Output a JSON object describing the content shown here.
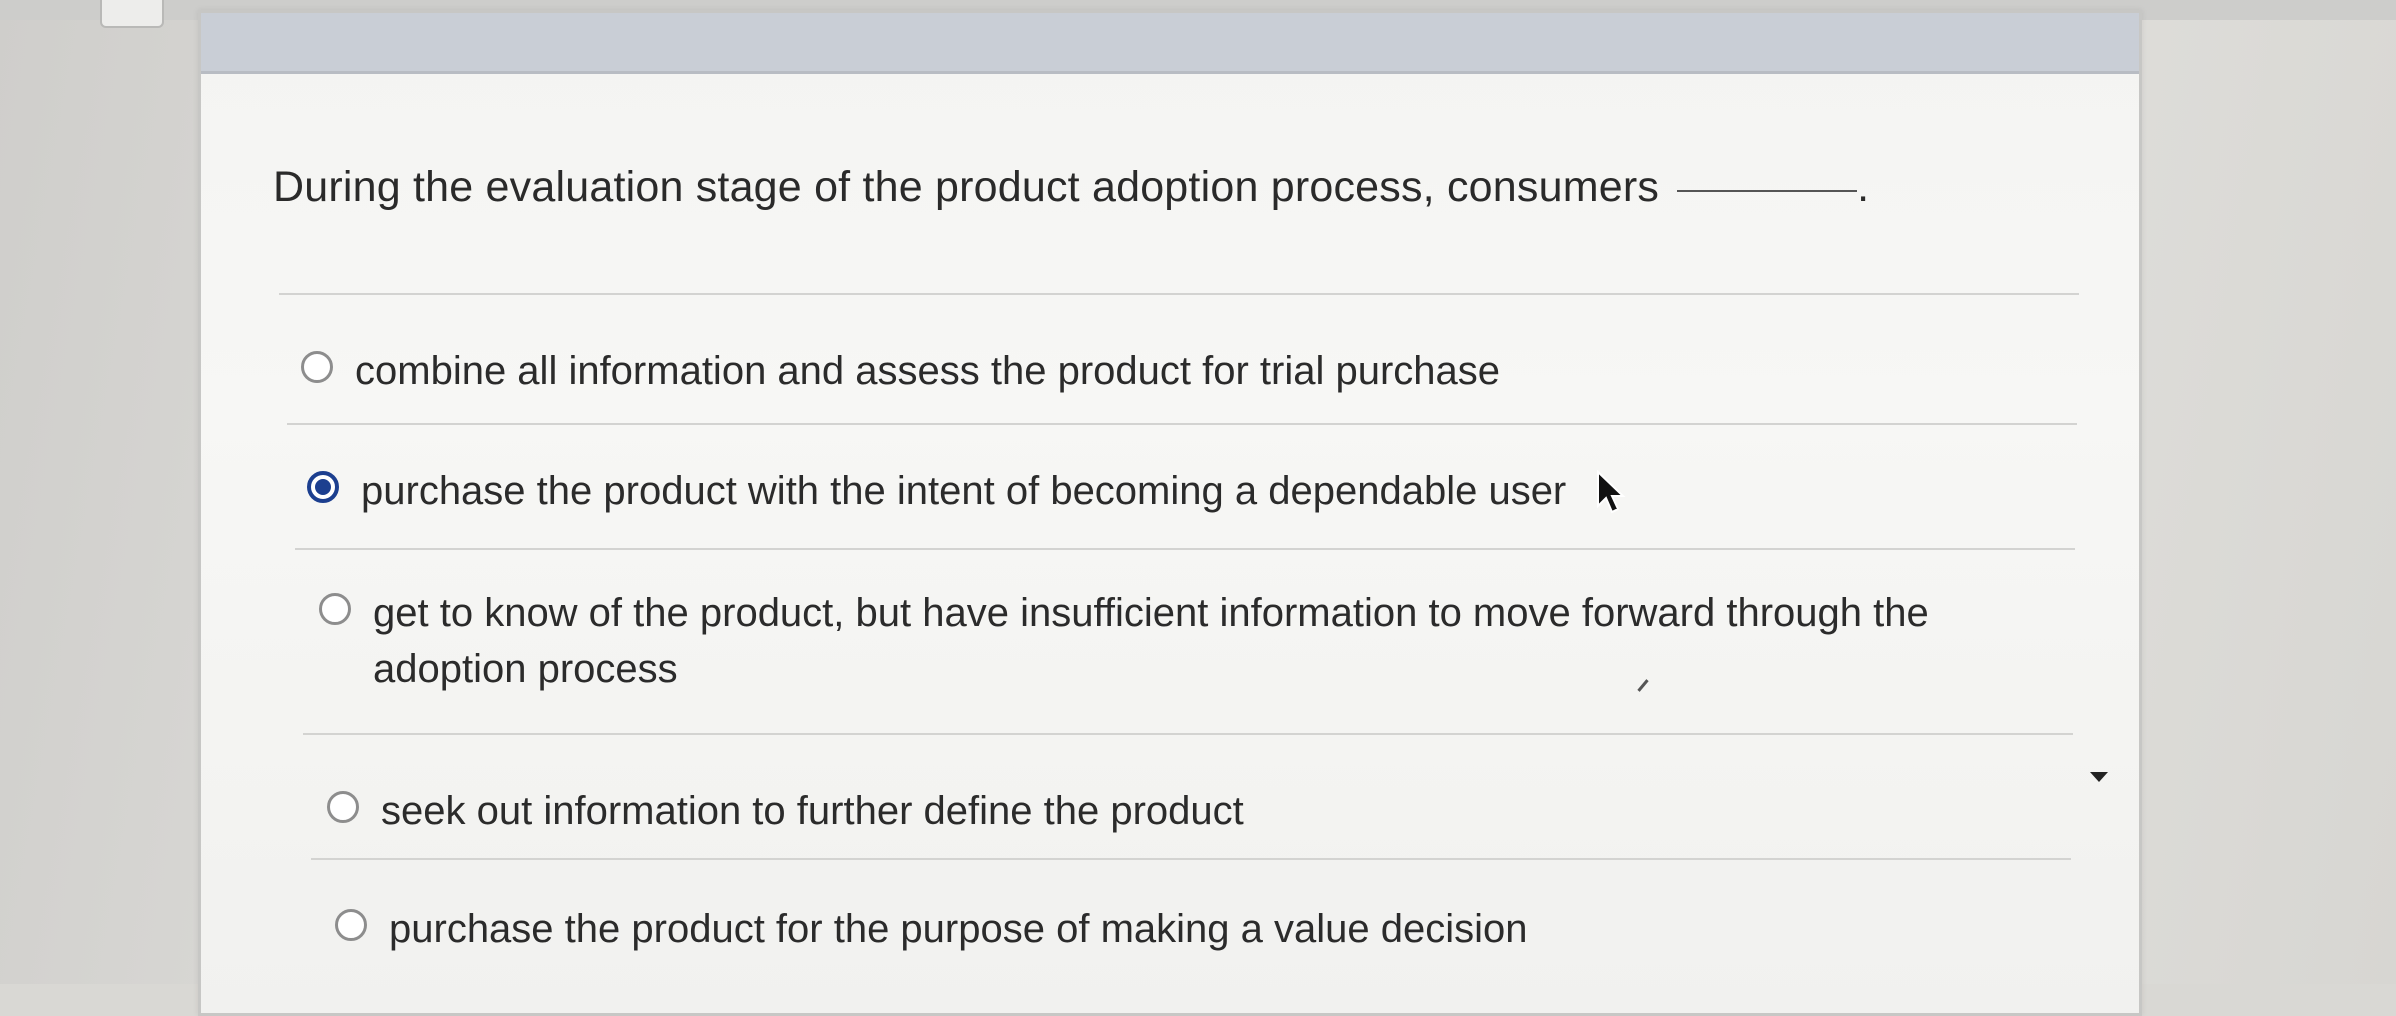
{
  "question": {
    "text": "During the evaluation stage of the product adoption process, consumers",
    "trailing_punctuation": "."
  },
  "options": [
    {
      "label": "combine all information and assess the product for trial purchase",
      "selected": false
    },
    {
      "label": "purchase the product with the intent of becoming a dependable user",
      "selected": true
    },
    {
      "label": "get to know of the product, but have insufficient information to move forward through the adoption process",
      "selected": false
    },
    {
      "label": "seek out information to further define the product",
      "selected": false
    },
    {
      "label": "purchase the product for the purpose of making a value decision",
      "selected": false
    }
  ],
  "icons": {
    "cursor": "mouse-pointer-icon",
    "dropdown": "caret-down-icon"
  },
  "colors": {
    "selected_radio": "#1c3f8f",
    "header_bar": "#c9ced6",
    "card_background": "#f5f5f3"
  }
}
